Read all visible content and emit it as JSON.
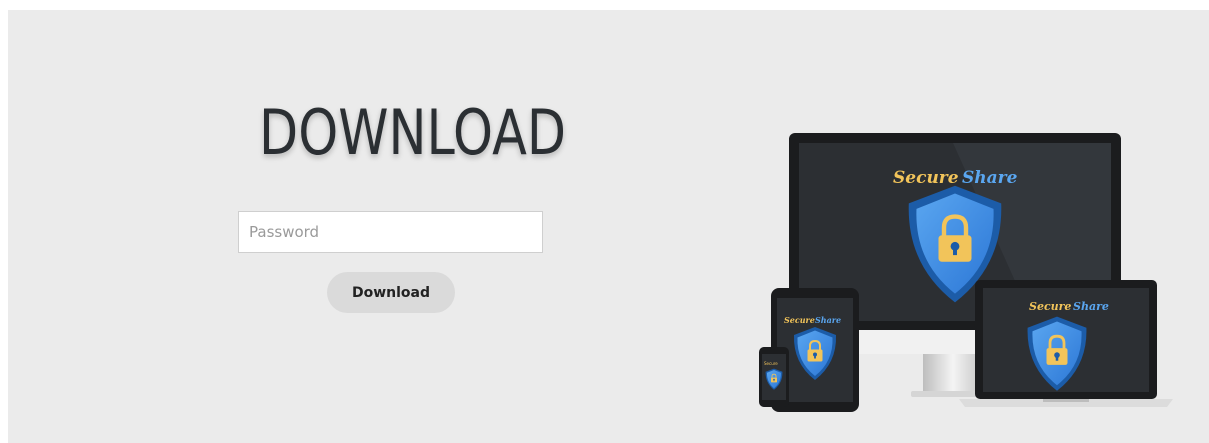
{
  "heading": "DOWNLOAD",
  "password_field": {
    "placeholder": "Password",
    "value": ""
  },
  "download_button": {
    "label": "Download"
  },
  "illustration": {
    "icon": "devices-secure-share-illustration",
    "brand": [
      "Secure",
      "Share"
    ],
    "colors": {
      "shield_blue": "#3d8fe8",
      "shield_dark": "#1c5ca8",
      "lock_gold": "#f2c45a",
      "screen": "#2c2f33",
      "bezel": "#1b1c1e"
    }
  }
}
